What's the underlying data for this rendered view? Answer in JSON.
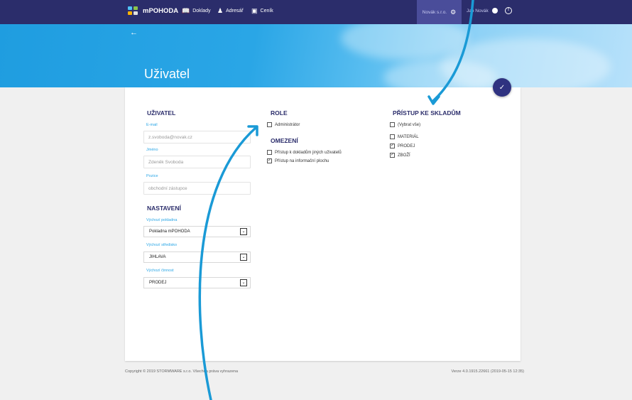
{
  "topbar": {
    "brand": "mPOHODA",
    "nav": [
      {
        "label": "Doklady",
        "icon": "book-icon"
      },
      {
        "label": "Adresář",
        "icon": "person-icon"
      },
      {
        "label": "Ceník",
        "icon": "catalog-icon"
      }
    ],
    "company": "Novák s.r.o.",
    "user": "Jan Novák"
  },
  "page": {
    "title": "Uživatel"
  },
  "user_section": {
    "heading": "UŽIVATEL",
    "fields": [
      {
        "label": "E-mail",
        "value": "z.svoboda@novak.cz"
      },
      {
        "label": "Jméno",
        "value": "Zdeněk Svoboda"
      },
      {
        "label": "Pozice",
        "value": "obchodní zástupce"
      }
    ]
  },
  "settings_section": {
    "heading": "NASTAVENÍ",
    "selects": [
      {
        "label": "Výchozí pokladna",
        "value": "Pokladna mPOHODA"
      },
      {
        "label": "Výchozí středisko",
        "value": "JIHLAVA"
      },
      {
        "label": "Výchozí činnost",
        "value": "PRODEJ"
      }
    ]
  },
  "role_section": {
    "heading": "ROLE",
    "items": [
      {
        "label": "Administrátor",
        "checked": false
      }
    ]
  },
  "restrict_section": {
    "heading": "OMEZENÍ",
    "items": [
      {
        "label": "Přístup k dokladům jiných uživatelů",
        "checked": false
      },
      {
        "label": "Přístup na informační plochu",
        "checked": true
      }
    ]
  },
  "warehouse_section": {
    "heading": "PŘÍSTUP KE SKLADŮM",
    "select_all": "(Vybrat vše)",
    "items": [
      {
        "label": "MATERIÁL",
        "checked": false
      },
      {
        "label": "PRODEJ",
        "checked": true
      },
      {
        "label": "ZBOŽÍ",
        "checked": true
      }
    ]
  },
  "footer": {
    "copyright": "Copyright © 2019 STORMWARE s.r.o. Všechna práva vyhrazena",
    "version": "Verze 4.0.1915.22661 (2019-05-15 12:35)"
  },
  "colors": {
    "topbar": "#2b2d6b",
    "accent": "#2aa6e6",
    "annotation_arrow": "#1a9ad6"
  }
}
